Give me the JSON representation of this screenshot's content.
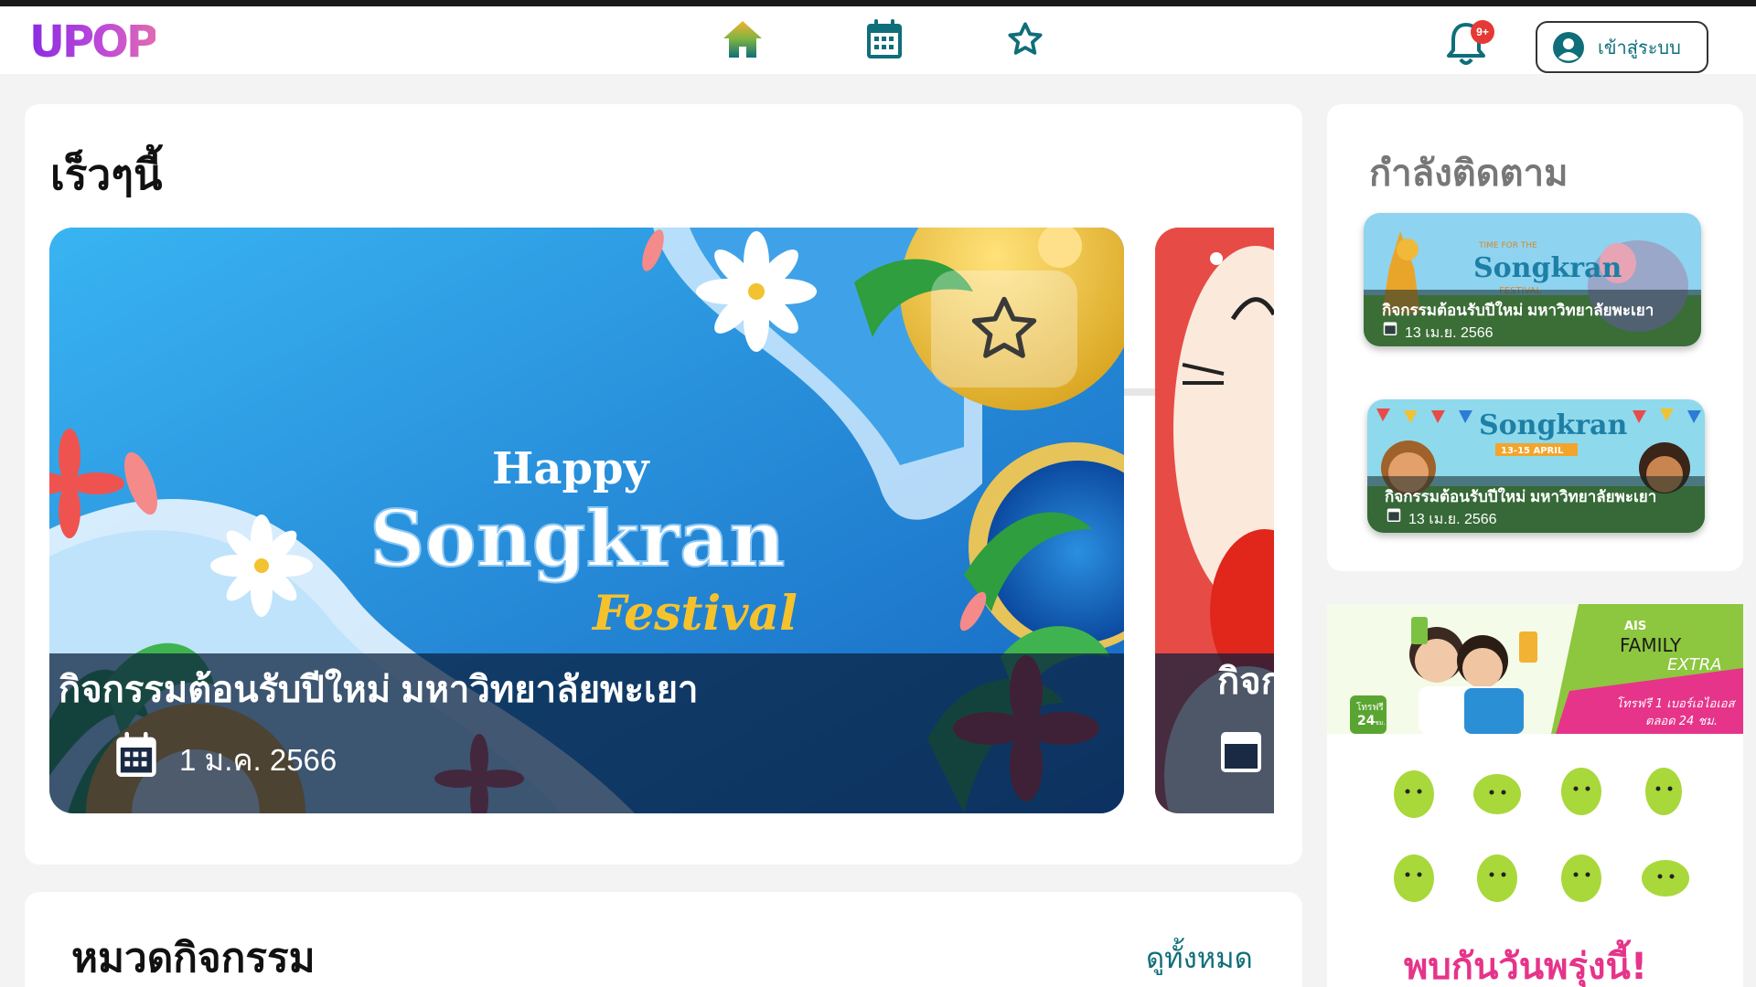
{
  "header": {
    "logo_text": "UPOP",
    "nav": [
      {
        "name": "home",
        "icon": "home-icon"
      },
      {
        "name": "calendar",
        "icon": "calendar-icon"
      },
      {
        "name": "favorites",
        "icon": "star-icon"
      }
    ],
    "notification_badge": "9+",
    "login_label": "เข้าสู่ระบบ"
  },
  "recent": {
    "title": "เร็วๆนี้",
    "events": [
      {
        "banner_line1": "Happy",
        "banner_line2": "Songkran",
        "banner_line3": "Festival",
        "title": "กิจกรรมต้อนรับปีใหม่ มหาวิทยาลัยพะเยา",
        "date": "1 ม.ค. 2566"
      },
      {
        "title_partial": "กิจก"
      }
    ]
  },
  "following": {
    "title": "กำลังติดตาม",
    "items": [
      {
        "banner_small": "TIME FOR THE",
        "banner": "Songkran",
        "banner_sub": "FESTIVAL",
        "title": "กิจกรรมต้อนรับปีใหม่ มหาวิทยาลัยพะเยา",
        "date": "13 เม.ย. 2566"
      },
      {
        "banner": "Songkran",
        "banner_sub": "13-15 APRIL",
        "title": "กิจกรรมต้อนรับปีใหม่ มหาวิทยาลัยพะเยา",
        "date": "13 เม.ย. 2566"
      }
    ]
  },
  "categories": {
    "title": "หมวดกิจกรรม",
    "view_all": "ดูทั้งหมด"
  },
  "ad": {
    "brand": "AIS",
    "line1": "FAMILY",
    "line2": "EXTRA",
    "promo": "โทรฟรี 1 เบอร์เอไอเอส",
    "promo2": "ตลอด 24 ชม.",
    "badge_text": "โทรฟรี",
    "badge_num": "24",
    "badge_unit": "ชม.",
    "footer": "พบกันวันพรุ่งนี้!"
  },
  "colors": {
    "accent": "#0f6e7a",
    "logo": "#7b2fd6",
    "badge": "#e53935",
    "ad_green": "#8dc63f",
    "ad_pink": "#e6348a"
  }
}
